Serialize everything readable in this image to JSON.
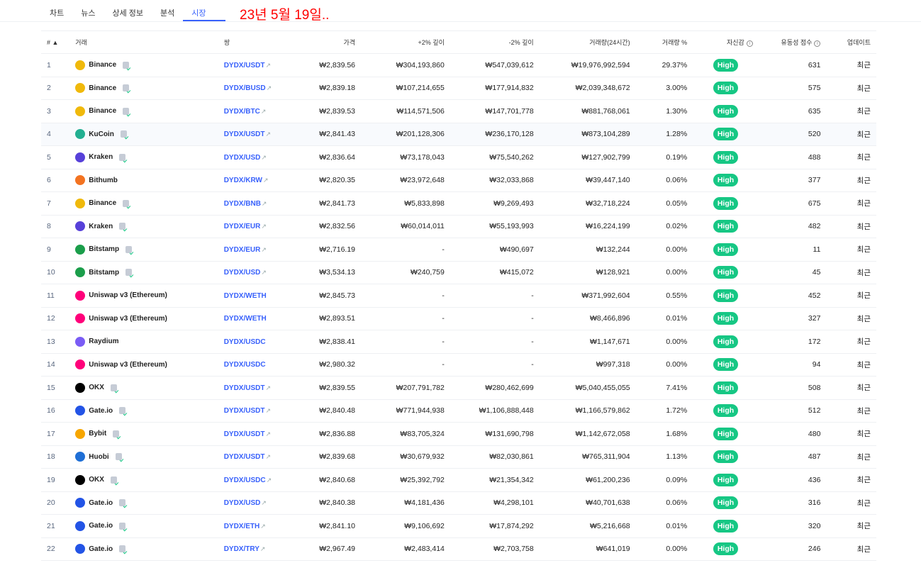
{
  "tabs": [
    "차트",
    "뉴스",
    "상세 정보",
    "분석",
    "시장"
  ],
  "note": "23년 5월 19일..",
  "headers": {
    "rank": "#",
    "exchange": "거래",
    "pair": "쌍",
    "price": "가격",
    "plus2": "+2% 깊이",
    "minus2": "-2% 깊이",
    "volume": "거래량(24시간)",
    "volpct": "거래량 %",
    "confidence": "자신감",
    "liquidity": "유동성 점수",
    "updated": "업데이트"
  },
  "sort_icon": "caret-up",
  "colors": {
    "accent": "#3861fb",
    "high": "#16c784"
  },
  "rows": [
    {
      "n": "1",
      "ex": "Binance",
      "icon": "#f0b90b",
      "pair": "DYDX/USDT",
      "link": true,
      "price": "₩2,839.56",
      "p2": "₩304,193,860",
      "m2": "₩547,039,612",
      "vol": "₩19,976,992,594",
      "pct": "29.37%",
      "conf": "High",
      "liq": "631",
      "upd": "최근"
    },
    {
      "n": "2",
      "ex": "Binance",
      "icon": "#f0b90b",
      "pair": "DYDX/BUSD",
      "link": true,
      "price": "₩2,839.18",
      "p2": "₩107,214,655",
      "m2": "₩177,914,832",
      "vol": "₩2,039,348,672",
      "pct": "3.00%",
      "conf": "High",
      "liq": "575",
      "upd": "최근"
    },
    {
      "n": "3",
      "ex": "Binance",
      "icon": "#f0b90b",
      "pair": "DYDX/BTC",
      "link": true,
      "price": "₩2,839.53",
      "p2": "₩114,571,506",
      "m2": "₩147,701,778",
      "vol": "₩881,768,061",
      "pct": "1.30%",
      "conf": "High",
      "liq": "635",
      "upd": "최근"
    },
    {
      "n": "4",
      "ex": "KuCoin",
      "icon": "#23af91",
      "pair": "DYDX/USDT",
      "link": true,
      "price": "₩2,841.43",
      "p2": "₩201,128,306",
      "m2": "₩236,170,128",
      "vol": "₩873,104,289",
      "pct": "1.28%",
      "conf": "High",
      "liq": "520",
      "upd": "최근"
    },
    {
      "n": "5",
      "ex": "Kraken",
      "icon": "#5741d9",
      "pair": "DYDX/USD",
      "link": true,
      "price": "₩2,836.64",
      "p2": "₩73,178,043",
      "m2": "₩75,540,262",
      "vol": "₩127,902,799",
      "pct": "0.19%",
      "conf": "High",
      "liq": "488",
      "upd": "최근"
    },
    {
      "n": "6",
      "ex": "Bithumb",
      "icon": "#f37321",
      "pair": "DYDX/KRW",
      "link": true,
      "price": "₩2,820.35",
      "p2": "₩23,972,648",
      "m2": "₩32,033,868",
      "vol": "₩39,447,140",
      "pct": "0.06%",
      "conf": "High",
      "liq": "377",
      "upd": "최근"
    },
    {
      "n": "7",
      "ex": "Binance",
      "icon": "#f0b90b",
      "pair": "DYDX/BNB",
      "link": true,
      "price": "₩2,841.73",
      "p2": "₩5,833,898",
      "m2": "₩9,269,493",
      "vol": "₩32,718,224",
      "pct": "0.05%",
      "conf": "High",
      "liq": "675",
      "upd": "최근"
    },
    {
      "n": "8",
      "ex": "Kraken",
      "icon": "#5741d9",
      "pair": "DYDX/EUR",
      "link": true,
      "price": "₩2,832.56",
      "p2": "₩60,014,011",
      "m2": "₩55,193,993",
      "vol": "₩16,224,199",
      "pct": "0.02%",
      "conf": "High",
      "liq": "482",
      "upd": "최근"
    },
    {
      "n": "9",
      "ex": "Bitstamp",
      "icon": "#1b9e4b",
      "pair": "DYDX/EUR",
      "link": true,
      "price": "₩2,716.19",
      "p2": "-",
      "m2": "₩490,697",
      "vol": "₩132,244",
      "pct": "0.00%",
      "conf": "High",
      "liq": "11",
      "upd": "최근"
    },
    {
      "n": "10",
      "ex": "Bitstamp",
      "icon": "#1b9e4b",
      "pair": "DYDX/USD",
      "link": true,
      "price": "₩3,534.13",
      "p2": "₩240,759",
      "m2": "₩415,072",
      "vol": "₩128,921",
      "pct": "0.00%",
      "conf": "High",
      "liq": "45",
      "upd": "최근"
    },
    {
      "n": "11",
      "ex": "Uniswap v3 (Ethereum)",
      "icon": "#ff007a",
      "pair": "DYDX/WETH",
      "link": false,
      "price": "₩2,845.73",
      "p2": "-",
      "m2": "-",
      "vol": "₩371,992,604",
      "pct": "0.55%",
      "conf": "High",
      "liq": "452",
      "upd": "최근"
    },
    {
      "n": "12",
      "ex": "Uniswap v3 (Ethereum)",
      "icon": "#ff007a",
      "pair": "DYDX/WETH",
      "link": false,
      "price": "₩2,893.51",
      "p2": "-",
      "m2": "-",
      "vol": "₩8,466,896",
      "pct": "0.01%",
      "conf": "High",
      "liq": "327",
      "upd": "최근"
    },
    {
      "n": "13",
      "ex": "Raydium",
      "icon": "#7a5cf5",
      "pair": "DYDX/USDC",
      "link": false,
      "price": "₩2,838.41",
      "p2": "-",
      "m2": "-",
      "vol": "₩1,147,671",
      "pct": "0.00%",
      "conf": "High",
      "liq": "172",
      "upd": "최근"
    },
    {
      "n": "14",
      "ex": "Uniswap v3 (Ethereum)",
      "icon": "#ff007a",
      "pair": "DYDX/USDC",
      "link": false,
      "price": "₩2,980.32",
      "p2": "-",
      "m2": "-",
      "vol": "₩997,318",
      "pct": "0.00%",
      "conf": "High",
      "liq": "94",
      "upd": "최근"
    },
    {
      "n": "15",
      "ex": "OKX",
      "icon": "#000000",
      "pair": "DYDX/USDT",
      "link": true,
      "price": "₩2,839.55",
      "p2": "₩207,791,782",
      "m2": "₩280,462,699",
      "vol": "₩5,040,455,055",
      "pct": "7.41%",
      "conf": "High",
      "liq": "508",
      "upd": "최근"
    },
    {
      "n": "16",
      "ex": "Gate.io",
      "icon": "#2354e6",
      "pair": "DYDX/USDT",
      "link": true,
      "price": "₩2,840.48",
      "p2": "₩771,944,938",
      "m2": "₩1,106,888,448",
      "vol": "₩1,166,579,862",
      "pct": "1.72%",
      "conf": "High",
      "liq": "512",
      "upd": "최근"
    },
    {
      "n": "17",
      "ex": "Bybit",
      "icon": "#f7a600",
      "pair": "DYDX/USDT",
      "link": true,
      "price": "₩2,836.88",
      "p2": "₩83,705,324",
      "m2": "₩131,690,798",
      "vol": "₩1,142,672,058",
      "pct": "1.68%",
      "conf": "High",
      "liq": "480",
      "upd": "최근"
    },
    {
      "n": "18",
      "ex": "Huobi",
      "icon": "#1f6fd6",
      "pair": "DYDX/USDT",
      "link": true,
      "price": "₩2,839.68",
      "p2": "₩30,679,932",
      "m2": "₩82,030,861",
      "vol": "₩765,311,904",
      "pct": "1.13%",
      "conf": "High",
      "liq": "487",
      "upd": "최근"
    },
    {
      "n": "19",
      "ex": "OKX",
      "icon": "#000000",
      "pair": "DYDX/USDC",
      "link": true,
      "price": "₩2,840.68",
      "p2": "₩25,392,792",
      "m2": "₩21,354,342",
      "vol": "₩61,200,236",
      "pct": "0.09%",
      "conf": "High",
      "liq": "436",
      "upd": "최근"
    },
    {
      "n": "20",
      "ex": "Gate.io",
      "icon": "#2354e6",
      "pair": "DYDX/USD",
      "link": true,
      "price": "₩2,840.38",
      "p2": "₩4,181,436",
      "m2": "₩4,298,101",
      "vol": "₩40,701,638",
      "pct": "0.06%",
      "conf": "High",
      "liq": "316",
      "upd": "최근"
    },
    {
      "n": "21",
      "ex": "Gate.io",
      "icon": "#2354e6",
      "pair": "DYDX/ETH",
      "link": true,
      "price": "₩2,841.10",
      "p2": "₩9,106,692",
      "m2": "₩17,874,292",
      "vol": "₩5,216,668",
      "pct": "0.01%",
      "conf": "High",
      "liq": "320",
      "upd": "최근"
    },
    {
      "n": "22",
      "ex": "Gate.io",
      "icon": "#2354e6",
      "pair": "DYDX/TRY",
      "link": true,
      "price": "₩2,967.49",
      "p2": "₩2,483,414",
      "m2": "₩2,703,758",
      "vol": "₩641,019",
      "pct": "0.00%",
      "conf": "High",
      "liq": "246",
      "upd": "최근"
    }
  ]
}
